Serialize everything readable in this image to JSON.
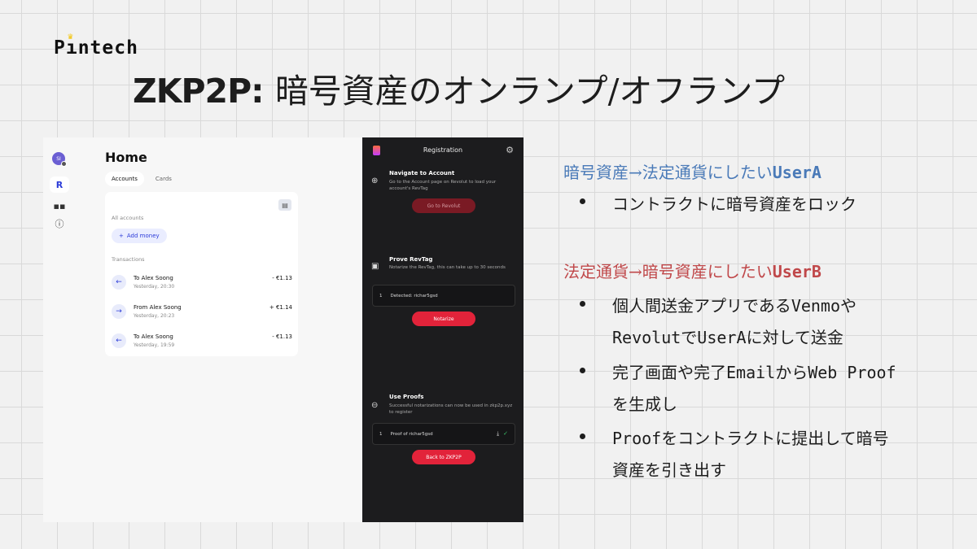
{
  "logo": {
    "text": "Pıntech"
  },
  "title": {
    "en": "ZKP2P:",
    "jp": "暗号資産のオンランプ/オフランプ"
  },
  "revolut": {
    "avatar": "SI",
    "home_title": "Home",
    "tabs": [
      "Accounts",
      "Cards"
    ],
    "all_accounts": "All accounts",
    "add_money": "Add money",
    "transactions_label": "Transactions",
    "transactions": [
      {
        "name": "To Alex Soong",
        "time": "Yesterday, 20:30",
        "amount": "- €1.13",
        "dir": "in"
      },
      {
        "name": "From Alex Soong",
        "time": "Yesterday, 20:23",
        "amount": "+ €1.14",
        "dir": "out"
      },
      {
        "name": "To Alex Soong",
        "time": "Yesterday, 19:59",
        "amount": "- €1.13",
        "dir": "in"
      }
    ]
  },
  "extension": {
    "header": "Registration",
    "step1": {
      "title": "Navigate to Account",
      "desc": "Go to the Account page on Revolut to load your account's RevTag",
      "button": "Go to Revolut"
    },
    "step2": {
      "title": "Prove RevTag",
      "desc": "Notarize the RevTag, this can take up to 30 seconds",
      "item_index": "1",
      "item": "Detected: richar5gsd",
      "button": "Notarize"
    },
    "step3": {
      "title": "Use Proofs",
      "desc": "Successful notarizations can now be used in zkp2p.xyz to register",
      "item_index": "1",
      "item": "Proof of richar5gsd",
      "button": "Back to ZKP2P"
    }
  },
  "right": {
    "heading_a_pre": "暗号資産→法定通貨にしたい",
    "heading_a_user": "UserA",
    "a_items": [
      "コントラクトに暗号資産をロック"
    ],
    "heading_b_pre": "法定通貨→暗号資産にしたい",
    "heading_b_user": "UserB",
    "b1_pre": "個人間送金アプリである",
    "b1_m": "Venmo",
    "b1_post": "や",
    "b1_l2_m": "Revolut",
    "b1_l2_mid": "で",
    "b1_l2_m2": "UserA",
    "b1_l2_post": "に対して送金",
    "b2_pre": "完了画面や完了",
    "b2_m": "Email",
    "b2_mid": "から",
    "b2_m2": "Web Proof",
    "b2_l2": "を生成し",
    "b3_m": "Proof",
    "b3_post": "をコントラクトに提出して暗号",
    "b3_l2": "資産を引き出す"
  }
}
